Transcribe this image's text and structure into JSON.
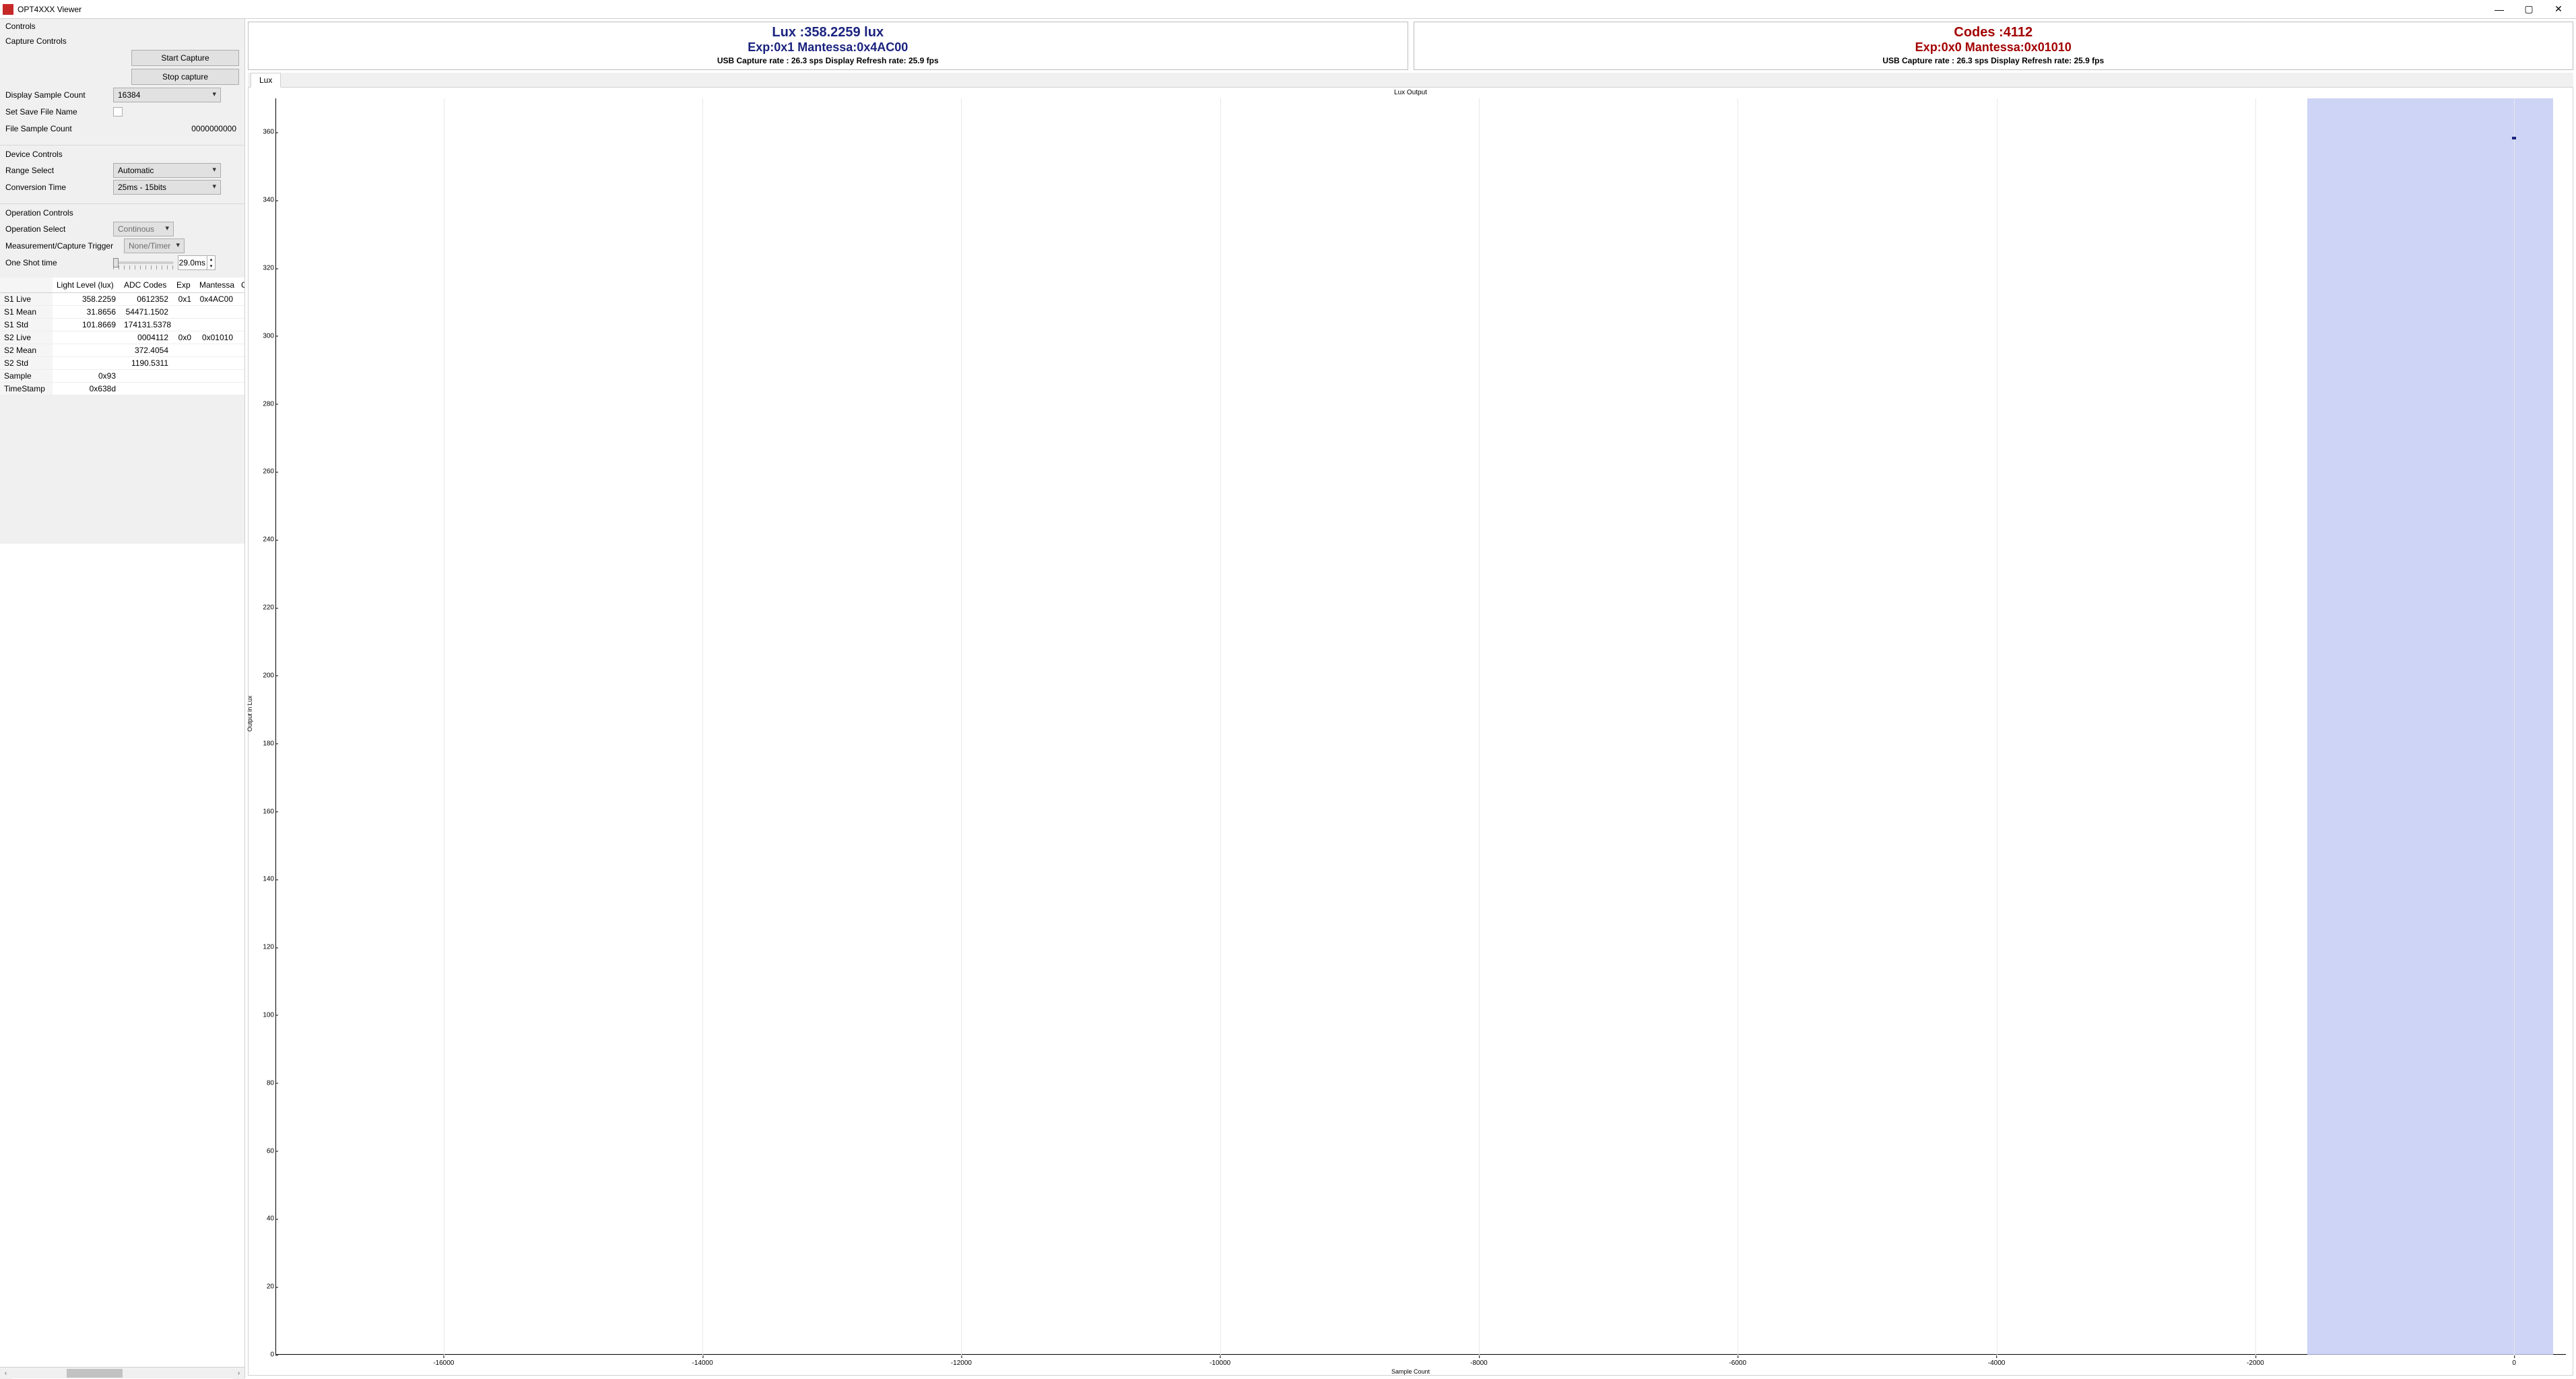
{
  "window": {
    "title": "OPT4XXX Viewer",
    "min": "—",
    "max": "▢",
    "close": "✕"
  },
  "left": {
    "controls_header": "Controls",
    "capture": {
      "title": "Capture Controls",
      "start": "Start Capture",
      "stop": "Stop capture",
      "display_sample_count_lbl": "Display Sample Count",
      "display_sample_count_val": "16384",
      "set_save_file_lbl": "Set Save File Name",
      "file_sample_count_lbl": "File Sample Count",
      "file_sample_count_val": "0000000000"
    },
    "device": {
      "title": "Device Controls",
      "range_lbl": "Range Select",
      "range_val": "Automatic",
      "conv_lbl": "Conversion Time",
      "conv_val": "25ms - 15bits"
    },
    "operation": {
      "title": "Operation Controls",
      "op_select_lbl": "Operation Select",
      "op_select_val": "Continous",
      "trigger_lbl": "Measurement/Capture Trigger",
      "trigger_val": "None/Timer",
      "oneshot_lbl": "One Shot time",
      "oneshot_val": "29.0ms"
    },
    "stats": {
      "headers": [
        "",
        "Light Level (lux)",
        "ADC Codes",
        "Exp",
        "Mantessa",
        "C"
      ],
      "rows": [
        [
          "S1 Live",
          "358.2259",
          "0612352",
          "0x1",
          "0x4AC00"
        ],
        [
          "S1 Mean",
          "31.8656",
          "54471.1502",
          "",
          ""
        ],
        [
          "S1 Std",
          "101.8669",
          "174131.5378",
          "",
          ""
        ],
        [
          "S2 Live",
          "",
          "0004112",
          "0x0",
          "0x01010"
        ],
        [
          "S2 Mean",
          "",
          "372.4054",
          "",
          ""
        ],
        [
          "S2 Std",
          "",
          "1190.5311",
          "",
          ""
        ],
        [
          "Sample",
          "0x93",
          "",
          "",
          ""
        ],
        [
          "TimeStamp",
          "0x638d",
          "",
          "",
          ""
        ]
      ]
    }
  },
  "readouts": {
    "lux": {
      "line1": "Lux :358.2259 lux",
      "line2": "Exp:0x1 Mantessa:0x4AC00",
      "rate": "USB Capture rate : 26.3 sps Display Refresh rate: 25.9 fps"
    },
    "codes": {
      "line1": "Codes :4112",
      "line2": "Exp:0x0 Mantessa:0x01010",
      "rate": "USB Capture rate : 26.3 sps Display Refresh rate: 25.9 fps"
    }
  },
  "chart": {
    "tab": "Lux",
    "title": "Lux Output",
    "ylabel": "Output in Lux",
    "xlabel": "Sample Count"
  },
  "chart_data": {
    "type": "line",
    "title": "Lux Output",
    "xlabel": "Sample Count",
    "ylabel": "Output in Lux",
    "xlim": [
      -17300,
      400
    ],
    "ylim": [
      0,
      370
    ],
    "x_ticks": [
      -16000,
      -14000,
      -12000,
      -10000,
      -8000,
      -6000,
      -4000,
      -2000,
      0
    ],
    "y_ticks": [
      0,
      20,
      40,
      60,
      80,
      100,
      120,
      140,
      160,
      180,
      200,
      220,
      240,
      260,
      280,
      300,
      320,
      340,
      360
    ],
    "grid_v_at": [
      -16000,
      -14000,
      -12000,
      -10000,
      -8000,
      -6000,
      -4000,
      -2000,
      0
    ],
    "shaded_region_x": [
      -1600,
      300
    ],
    "series": [
      {
        "name": "Lux",
        "x": [
          0
        ],
        "y": [
          358.2259
        ]
      }
    ]
  }
}
